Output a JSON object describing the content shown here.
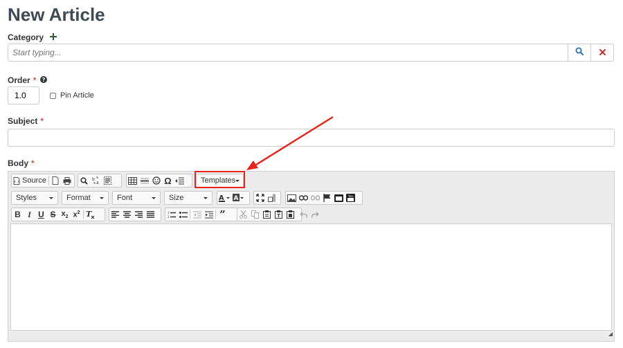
{
  "page": {
    "title": "New Article"
  },
  "category": {
    "label": "Category",
    "add_icon": "plus-icon",
    "placeholder": "Start typing...",
    "search_icon": "search-icon",
    "clear_icon": "close-icon"
  },
  "order": {
    "label": "Order",
    "required_mark": "*",
    "help_icon": "question-circle-icon",
    "value": "1.0",
    "pin_label": "Pin Article",
    "pin_checked": false
  },
  "subject": {
    "label": "Subject",
    "required_mark": "*",
    "value": ""
  },
  "body": {
    "label": "Body",
    "required_mark": "*",
    "toolbar": {
      "source_label": "Source",
      "templates_label": "Templates",
      "styles_label": "Styles",
      "format_label": "Format",
      "font_label": "Font",
      "size_label": "Size"
    }
  },
  "annotation": {
    "highlight_color": "#e8231a",
    "target": "Templates"
  },
  "colors": {
    "title": "#3f4a52",
    "required": "#d9534f",
    "search": "#2a6ebb",
    "clear": "#c9302c"
  }
}
